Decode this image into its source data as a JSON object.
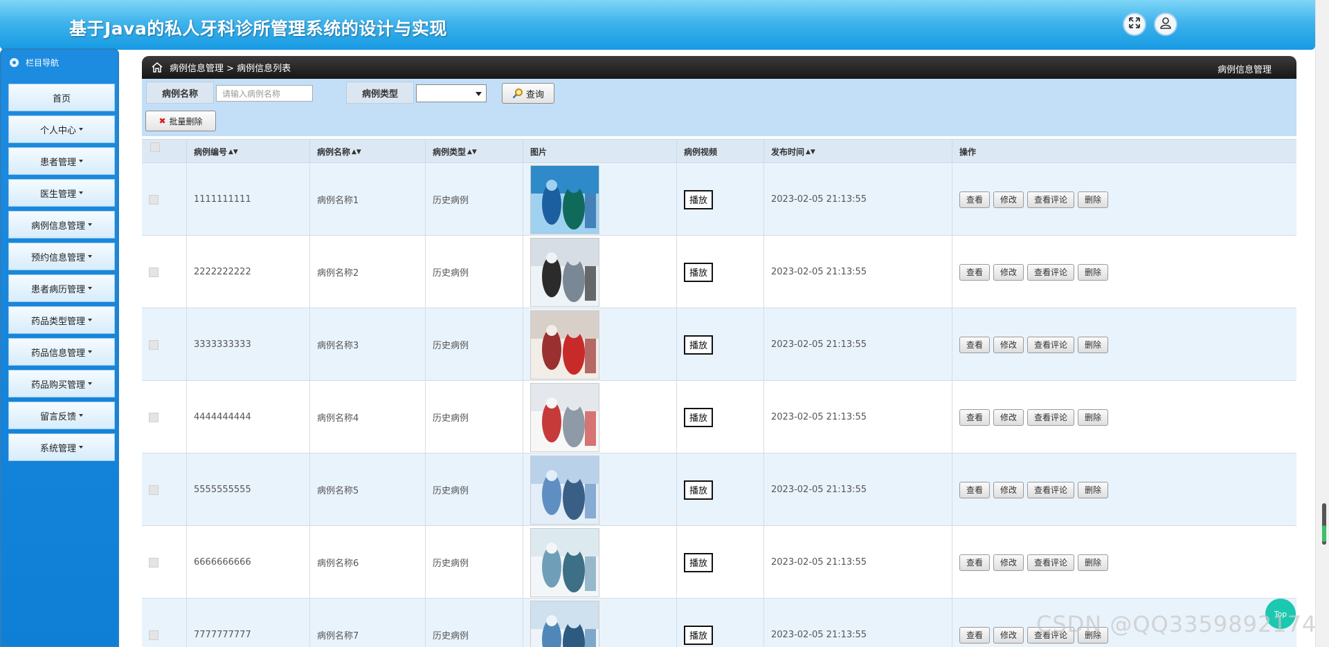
{
  "app": {
    "title": "基于Java的私人牙科诊所管理系统的设计与实现"
  },
  "header": {
    "icons": [
      "fullscreen-icon",
      "user-icon"
    ]
  },
  "sidebar": {
    "title": "栏目导航",
    "items": [
      {
        "label": "首页",
        "dropdown": false
      },
      {
        "label": "个人中心",
        "dropdown": true
      },
      {
        "label": "患者管理",
        "dropdown": true
      },
      {
        "label": "医生管理",
        "dropdown": true
      },
      {
        "label": "病例信息管理",
        "dropdown": true
      },
      {
        "label": "预约信息管理",
        "dropdown": true
      },
      {
        "label": "患者病历管理",
        "dropdown": true
      },
      {
        "label": "药品类型管理",
        "dropdown": true
      },
      {
        "label": "药品信息管理",
        "dropdown": true
      },
      {
        "label": "药品购买管理",
        "dropdown": true
      },
      {
        "label": "留言反馈",
        "dropdown": true
      },
      {
        "label": "系统管理",
        "dropdown": true
      }
    ]
  },
  "breadcrumb": {
    "path": "病例信息管理 > 病例信息列表",
    "right": "病例信息管理"
  },
  "search": {
    "name_label": "病例名称",
    "name_placeholder": "请输入病例名称",
    "type_label": "病例类型",
    "type_value": "",
    "search_button": "查询",
    "batch_delete_button": "批量删除"
  },
  "table": {
    "columns": [
      "病例编号",
      "病例名称",
      "病例类型",
      "图片",
      "病例视频",
      "发布时间",
      "操作"
    ],
    "rows": [
      {
        "id": "1111111111",
        "name": "病例名称1",
        "type": "历史病例",
        "video": "播放",
        "time": "2023-02-05 21:13:55"
      },
      {
        "id": "2222222222",
        "name": "病例名称2",
        "type": "历史病例",
        "video": "播放",
        "time": "2023-02-05 21:13:55"
      },
      {
        "id": "3333333333",
        "name": "病例名称3",
        "type": "历史病例",
        "video": "播放",
        "time": "2023-02-05 21:13:55"
      },
      {
        "id": "4444444444",
        "name": "病例名称4",
        "type": "历史病例",
        "video": "播放",
        "time": "2023-02-05 21:13:55"
      },
      {
        "id": "5555555555",
        "name": "病例名称5",
        "type": "历史病例",
        "video": "播放",
        "time": "2023-02-05 21:13:55"
      },
      {
        "id": "6666666666",
        "name": "病例名称6",
        "type": "历史病例",
        "video": "播放",
        "time": "2023-02-05 21:13:55"
      },
      {
        "id": "7777777777",
        "name": "病例名称7",
        "type": "历史病例",
        "video": "播放",
        "time": "2023-02-05 21:13:55"
      }
    ],
    "actions": [
      "查看",
      "修改",
      "查看评论",
      "删除"
    ]
  },
  "float": {
    "top_label": "Top"
  },
  "watermark": "CSDN @QQ3359892174",
  "colors": {
    "header": "#1a9de3",
    "sidebar": "#1084d8",
    "crumbbar": "#222222",
    "search_panel": "#c3dff7",
    "row_alt": "#e9f3fc"
  }
}
